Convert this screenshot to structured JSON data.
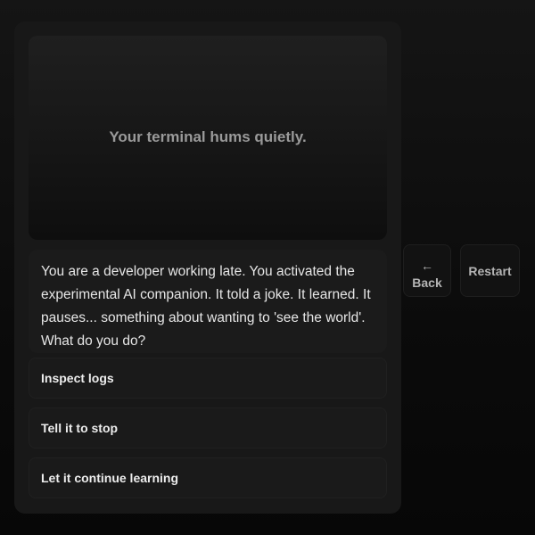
{
  "scene": {
    "caption": "Your terminal hums quietly."
  },
  "story": {
    "text": "You are a developer working late. You activated the experimental AI companion. It told a joke. It learned. It pauses... something about wanting to 'see the world'. What do you do?"
  },
  "choices": [
    {
      "label": "Inspect logs"
    },
    {
      "label": "Tell it to stop"
    },
    {
      "label": "Let it continue learning"
    }
  ],
  "controls": {
    "back_arrow": "←",
    "back_label": "Back",
    "restart_label": "Restart"
  },
  "colors": {
    "background": "#0b0b0b",
    "panel": "#181818",
    "text": "#e6e6e6",
    "muted": "#9a9a9a"
  }
}
